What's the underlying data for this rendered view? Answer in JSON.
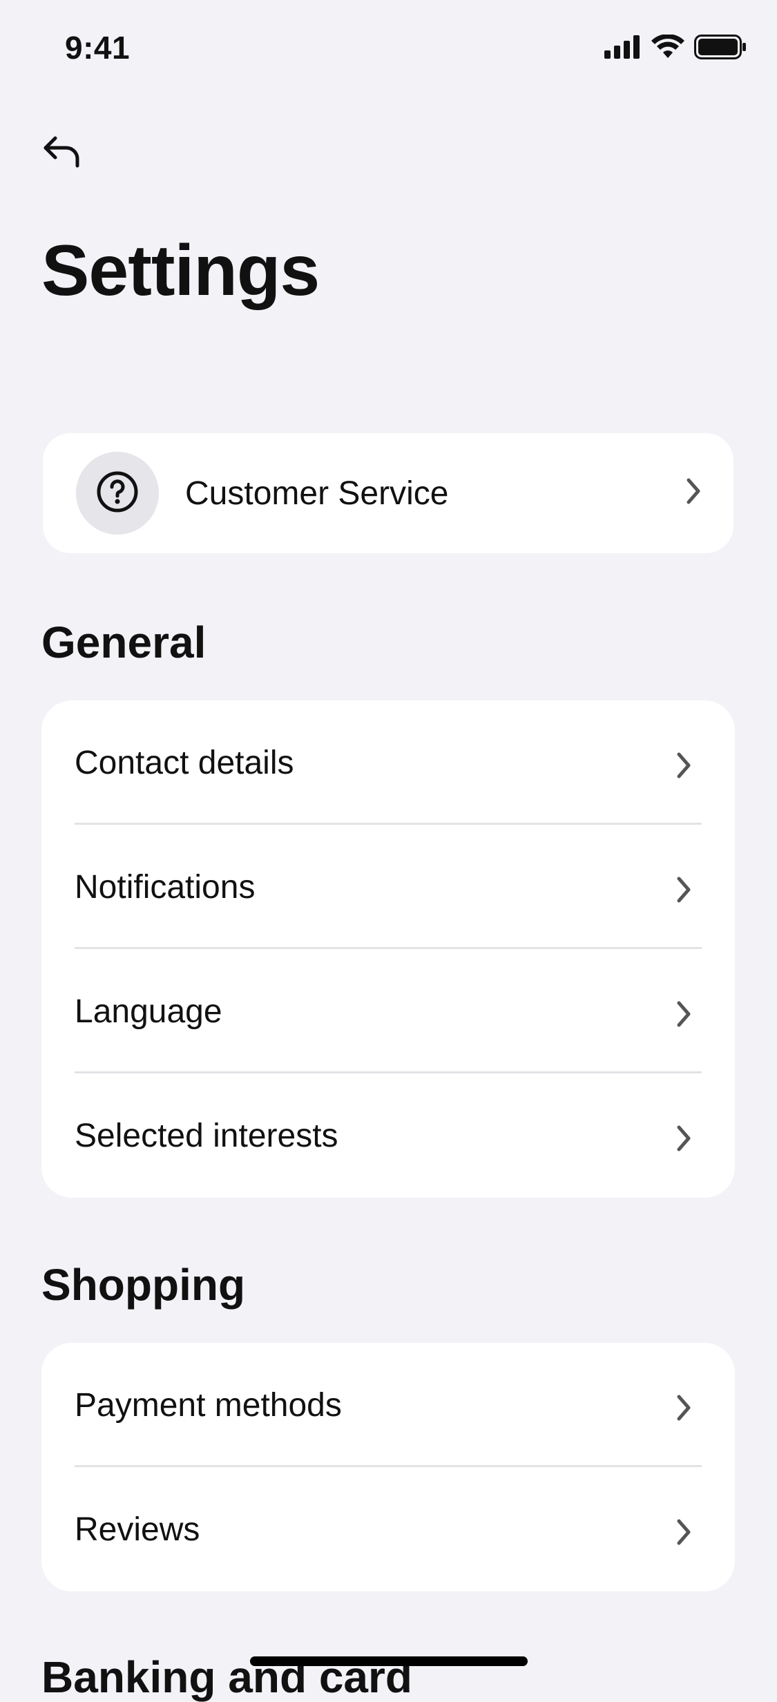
{
  "status_bar": {
    "time": "9:41",
    "icons": [
      "cellular-signal-icon",
      "wifi-icon",
      "battery-icon"
    ]
  },
  "nav": {
    "back_icon": "back-arrow-icon"
  },
  "page": {
    "title": "Settings"
  },
  "customer_service": {
    "icon": "question-circle-icon",
    "label": "Customer Service"
  },
  "sections": [
    {
      "title": "General",
      "items": [
        {
          "label": "Contact details"
        },
        {
          "label": "Notifications"
        },
        {
          "label": "Language"
        },
        {
          "label": "Selected interests"
        }
      ]
    },
    {
      "title": "Shopping",
      "items": [
        {
          "label": "Payment methods"
        },
        {
          "label": "Reviews"
        }
      ]
    },
    {
      "title": "Banking and card",
      "items": []
    }
  ],
  "colors": {
    "background": "#f2f2f7",
    "card": "#ffffff",
    "text": "#111111",
    "chevron": "#555555",
    "icon_circle": "#e5e5ea"
  }
}
